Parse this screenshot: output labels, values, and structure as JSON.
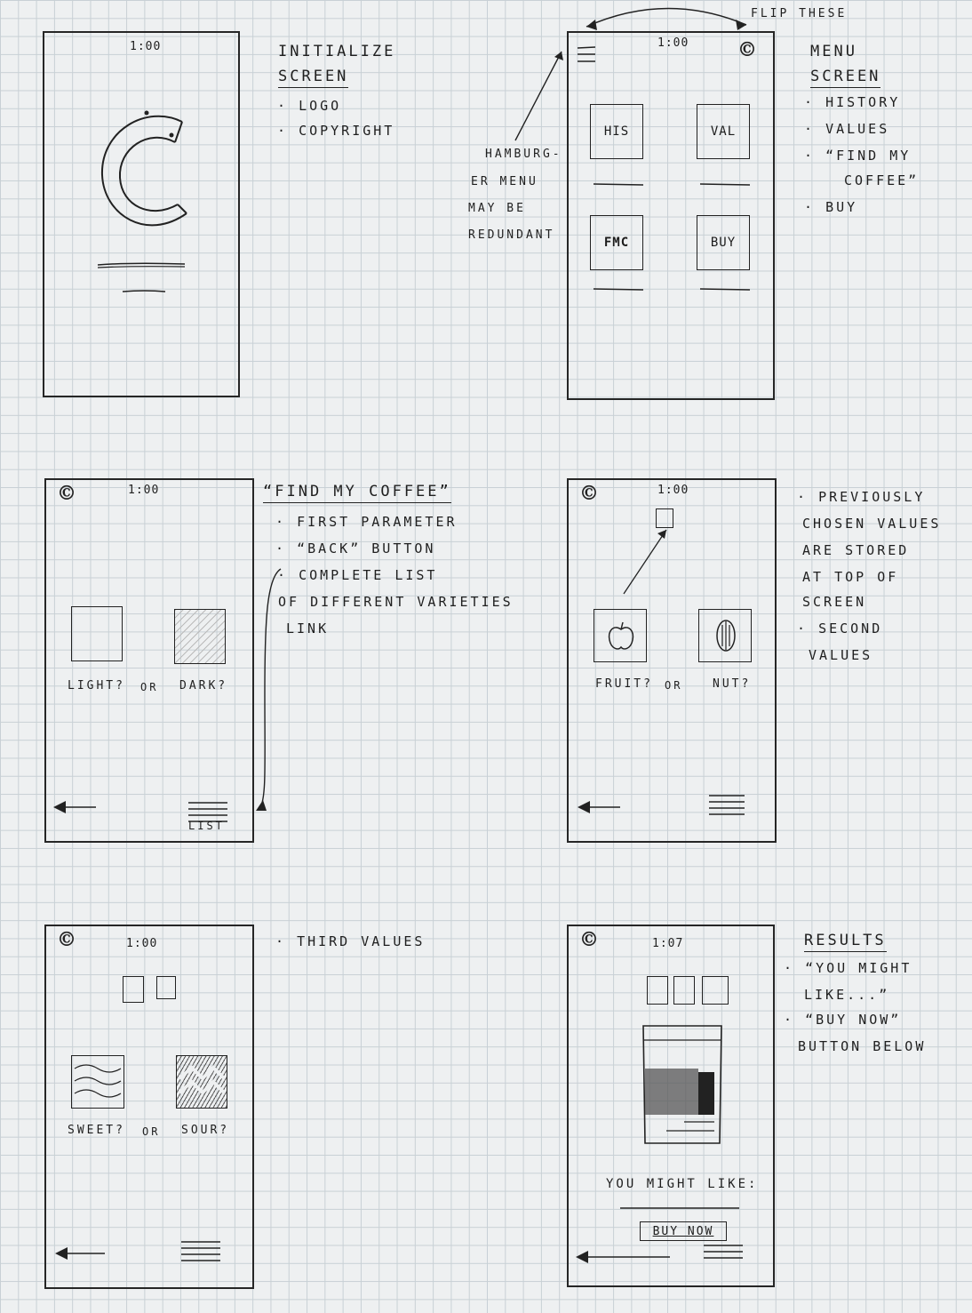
{
  "annotations": {
    "flip": "Flip these",
    "hamburger_note": [
      "Hamburg-",
      "er menu",
      "may be",
      "redundant"
    ]
  },
  "screen1": {
    "time": "1:00",
    "notes_title": [
      "Initialize",
      "Screen"
    ],
    "bullets": [
      "Logo",
      "Copyright"
    ]
  },
  "screen2": {
    "time": "1:00",
    "buttons": [
      "HIS",
      "VAL",
      "FMC",
      "BUY"
    ],
    "notes_title": [
      "Menu",
      "Screen"
    ],
    "bullets": [
      "History",
      "Values",
      "“Find my",
      "coffee”",
      "Buy"
    ]
  },
  "screen3": {
    "time": "1:00",
    "option_labels": [
      "Light?",
      "or",
      "Dark?"
    ],
    "list_label": "List",
    "notes_title": "“Find my coffee”",
    "bullets": [
      "First parameter",
      "“Back” button",
      "Complete list",
      "of different varieties",
      "link"
    ]
  },
  "screen4": {
    "time": "1:00",
    "option_labels": [
      "Fruit?",
      "or",
      "Nut?"
    ],
    "bullets": [
      "Previously",
      "chosen values",
      "are stored",
      "at top of",
      "screen",
      "Second",
      "values"
    ]
  },
  "screen5": {
    "time": "1:00",
    "option_labels": [
      "Sweet?",
      "or",
      "Sour?"
    ],
    "bullets": [
      "Third values"
    ]
  },
  "screen6": {
    "time": "1:07",
    "result_text": "You might like:",
    "buy_button": "Buy now",
    "notes_title": "Results",
    "bullets": [
      "“You might",
      "like...”",
      "“Buy now”",
      "button below"
    ]
  },
  "colors": {
    "ink": "#222222",
    "paper": "#eef0f1",
    "grid": "#c8d0d5"
  }
}
